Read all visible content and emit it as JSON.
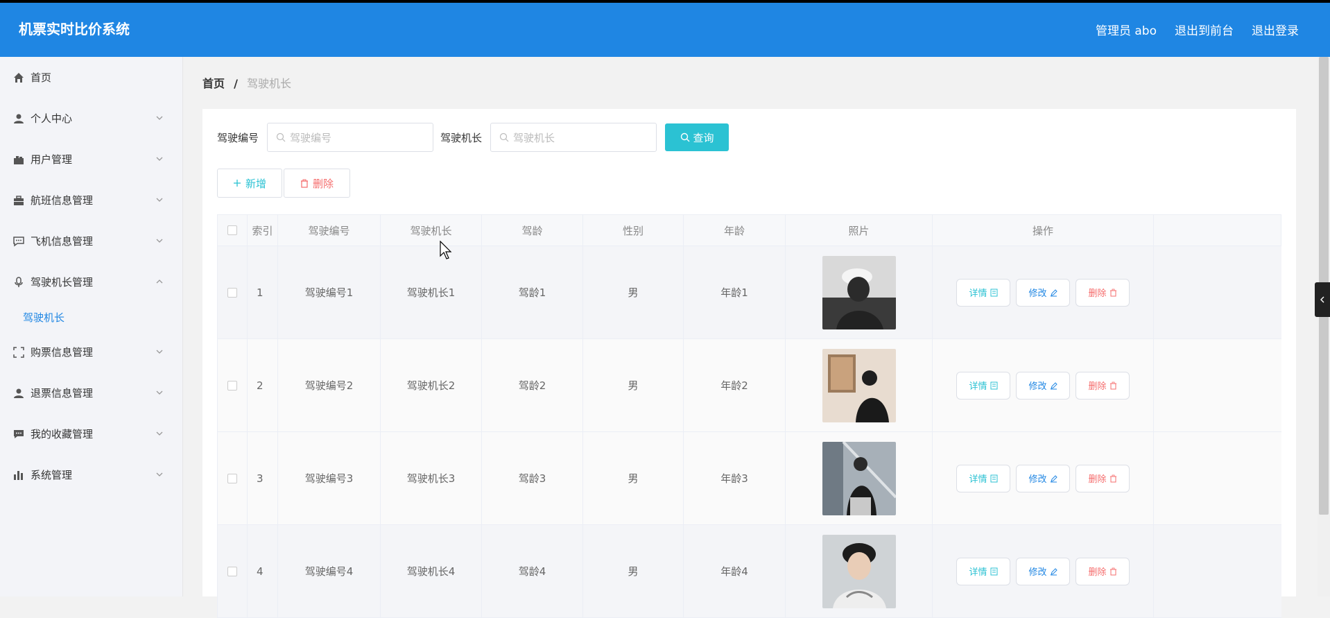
{
  "header": {
    "app_title": "机票实时比价系统",
    "admin_label": "管理员 abo",
    "back_to_front": "退出到前台",
    "logout": "退出登录"
  },
  "sidebar": {
    "items": [
      {
        "label": "首页",
        "icon": "home-icon"
      },
      {
        "label": "个人中心",
        "icon": "user-icon"
      },
      {
        "label": "用户管理",
        "icon": "users-icon"
      },
      {
        "label": "航班信息管理",
        "icon": "briefcase-icon"
      },
      {
        "label": "飞机信息管理",
        "icon": "chat-icon"
      },
      {
        "label": "驾驶机长管理",
        "icon": "mic-icon"
      },
      {
        "label": "购票信息管理",
        "icon": "fullscreen-icon"
      },
      {
        "label": "退票信息管理",
        "icon": "user-icon"
      },
      {
        "label": "我的收藏管理",
        "icon": "message-icon"
      },
      {
        "label": "系统管理",
        "icon": "chart-icon"
      }
    ],
    "sub_item": "驾驶机长"
  },
  "breadcrumb": {
    "home": "首页",
    "separator": "/",
    "current": "驾驶机长"
  },
  "search": {
    "field1_label": "驾驶编号",
    "field1_placeholder": "驾驶编号",
    "field2_label": "驾驶机长",
    "field2_placeholder": "驾驶机长",
    "query_button": "查询"
  },
  "actions": {
    "add": "新增",
    "delete": "删除"
  },
  "table": {
    "headers": [
      "索引",
      "驾驶编号",
      "驾驶机长",
      "驾龄",
      "性别",
      "年龄",
      "照片",
      "操作"
    ],
    "rows": [
      {
        "index": "1",
        "code": "驾驶编号1",
        "captain": "驾驶机长1",
        "years": "驾龄1",
        "gender": "男",
        "age": "年龄1"
      },
      {
        "index": "2",
        "code": "驾驶编号2",
        "captain": "驾驶机长2",
        "years": "驾龄2",
        "gender": "男",
        "age": "年龄2"
      },
      {
        "index": "3",
        "code": "驾驶编号3",
        "captain": "驾驶机长3",
        "years": "驾龄3",
        "gender": "男",
        "age": "年龄3"
      },
      {
        "index": "4",
        "code": "驾驶编号4",
        "captain": "驾驶机长4",
        "years": "驾龄4",
        "gender": "男",
        "age": "年龄4"
      }
    ],
    "op_detail": "详情",
    "op_edit": "修改",
    "op_delete": "删除"
  },
  "colors": {
    "primary": "#1f86e3",
    "accent": "#2bc2d3",
    "danger": "#f56c6c"
  }
}
